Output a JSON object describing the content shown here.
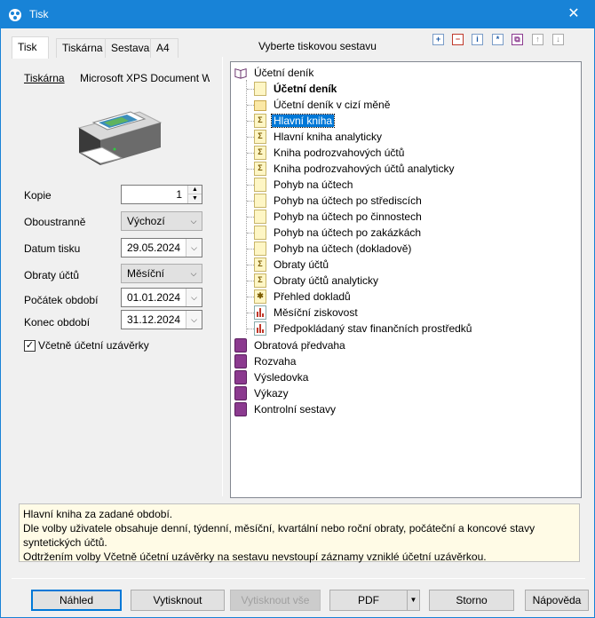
{
  "window": {
    "title": "Tisk",
    "close_glyph": "✕"
  },
  "tabs": [
    "Tisk",
    "Tiskárna",
    "Sestava",
    "A4"
  ],
  "left": {
    "printer_label": "Tiskárna",
    "printer_name": "Microsoft XPS Document Writer",
    "fields": {
      "kopie": {
        "label": "Kopie",
        "value": "1"
      },
      "oboustranne": {
        "label": "Oboustranně",
        "value": "Výchozí"
      },
      "datum_tisku": {
        "label": "Datum tisku",
        "value": "29.05.2024"
      },
      "obraty": {
        "label": "Obraty účtů",
        "value": "Měsíční"
      },
      "pocatek": {
        "label": "Počátek období",
        "value": "01.01.2024"
      },
      "konec": {
        "label": "Konec období",
        "value": "31.12.2024"
      }
    },
    "checkbox": {
      "label": "Včetně účetní uzávěrky",
      "checked": true
    }
  },
  "report_header": "Vyberte tiskovou sestavu",
  "toolbar_icons": [
    "add-icon",
    "remove-icon",
    "info-icon",
    "star-icon",
    "copy-icon",
    "move-up-icon",
    "move-down-icon"
  ],
  "tree": {
    "root": "Účetní deník",
    "children": [
      {
        "label": "Účetní deník",
        "icon": "doc",
        "bold": true
      },
      {
        "label": "Účetní deník v cizí měně",
        "icon": "folder"
      },
      {
        "label": "Hlavní kniha",
        "icon": "sum",
        "selected": true
      },
      {
        "label": "Hlavní kniha analyticky",
        "icon": "sum"
      },
      {
        "label": "Kniha podrozvahových účtů",
        "icon": "sum"
      },
      {
        "label": "Kniha podrozvahových účtů analyticky",
        "icon": "sum"
      },
      {
        "label": "Pohyb na účtech",
        "icon": "doc"
      },
      {
        "label": "Pohyb na účtech po střediscích",
        "icon": "doc"
      },
      {
        "label": "Pohyb na účtech po činnostech",
        "icon": "doc"
      },
      {
        "label": "Pohyb na účtech po zakázkách",
        "icon": "doc"
      },
      {
        "label": "Pohyb na účtech (dokladově)",
        "icon": "doc"
      },
      {
        "label": "Obraty účtů",
        "icon": "sum"
      },
      {
        "label": "Obraty účtů analyticky",
        "icon": "sum"
      },
      {
        "label": "Přehled dokladů",
        "icon": "star"
      },
      {
        "label": "Měsíční ziskovost",
        "icon": "chart"
      },
      {
        "label": "Předpokládaný stav finančních prostředků",
        "icon": "chart"
      }
    ],
    "top_level": [
      "Obratová předvaha",
      "Rozvaha",
      "Výsledovka",
      "Výkazy",
      "Kontrolní sestavy"
    ]
  },
  "description": [
    "Hlavní kniha za zadané období.",
    "Dle volby uživatele obsahuje denní, týdenní, měsíční, kvartální nebo roční obraty, počáteční a koncové stavy syntetických účtů.",
    "Odtržením volby Včetně účetní uzávěrky na sestavu nevstoupí záznamy vzniklé účetní uzávěrkou."
  ],
  "buttons": {
    "nahled": "Náhled",
    "vytisknout": "Vytisknout",
    "vytisknout_vse": "Vytisknout vše",
    "pdf": "PDF",
    "storno": "Storno",
    "napoveda": "Nápověda"
  },
  "colors": {
    "accent": "#1883d7",
    "selection": "#0078d7",
    "description_bg": "#fffbe6"
  }
}
